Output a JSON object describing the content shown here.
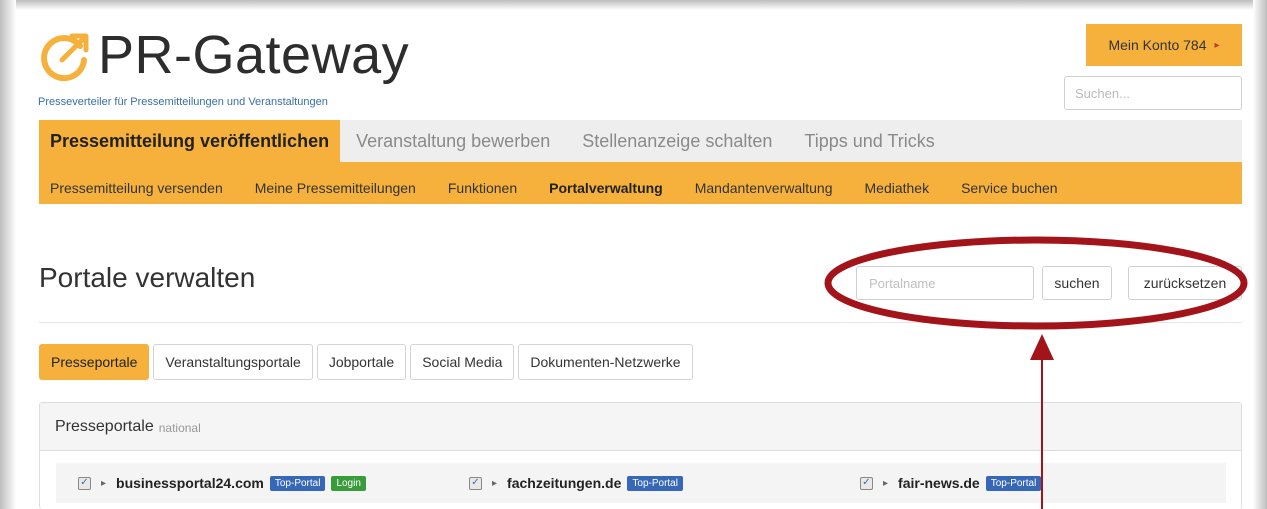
{
  "brand": {
    "name": "PR-Gateway",
    "tagline": "Presseverteiler für Pressemitteilungen und Veranstaltungen"
  },
  "account": {
    "label": "Mein Konto 784",
    "caret": "▸"
  },
  "search": {
    "placeholder": "Suchen..."
  },
  "main_nav": [
    {
      "label": "Pressemitteilung veröffentlichen",
      "active": true
    },
    {
      "label": "Veranstaltung bewerben",
      "active": false
    },
    {
      "label": "Stellenanzeige schalten",
      "active": false
    },
    {
      "label": "Tipps und Tricks",
      "active": false
    }
  ],
  "sub_nav": [
    {
      "label": "Pressemitteilung versenden",
      "active": false
    },
    {
      "label": "Meine Pressemitteilungen",
      "active": false
    },
    {
      "label": "Funktionen",
      "active": false
    },
    {
      "label": "Portalverwaltung",
      "active": true
    },
    {
      "label": "Mandantenverwaltung",
      "active": false
    },
    {
      "label": "Mediathek",
      "active": false
    },
    {
      "label": "Service buchen",
      "active": false
    }
  ],
  "page": {
    "title": "Portale verwalten",
    "portal_search_placeholder": "Portalname",
    "search_button": "suchen",
    "reset_button": "zurücksetzen"
  },
  "portal_tabs": [
    {
      "label": "Presseportale",
      "active": true
    },
    {
      "label": "Veranstaltungsportale",
      "active": false
    },
    {
      "label": "Jobportale",
      "active": false
    },
    {
      "label": "Social Media",
      "active": false
    },
    {
      "label": "Dokumenten-Netzwerke",
      "active": false
    }
  ],
  "panel": {
    "title": "Presseportale",
    "subtitle": "national"
  },
  "portals": [
    {
      "name": "businessportal24.com",
      "checked": true,
      "badges": [
        "Top-Portal",
        "Login"
      ]
    },
    {
      "name": "fachzeitungen.de",
      "checked": true,
      "badges": [
        "Top-Portal"
      ]
    },
    {
      "name": "fair-news.de",
      "checked": true,
      "badges": [
        "Top-Portal"
      ]
    }
  ],
  "colors": {
    "accent": "#f5b13c",
    "badge_blue": "#3768b8",
    "badge_green": "#3a9b3a",
    "annotation_red": "#a3141a",
    "tagline_blue": "#3a6ea5"
  },
  "icons": {
    "logo": "circular-arrow-logo-icon",
    "account_caret": "caret-icon",
    "portal_arrow": "expand-arrow-icon",
    "checkbox": "checkbox-checked-icon"
  }
}
